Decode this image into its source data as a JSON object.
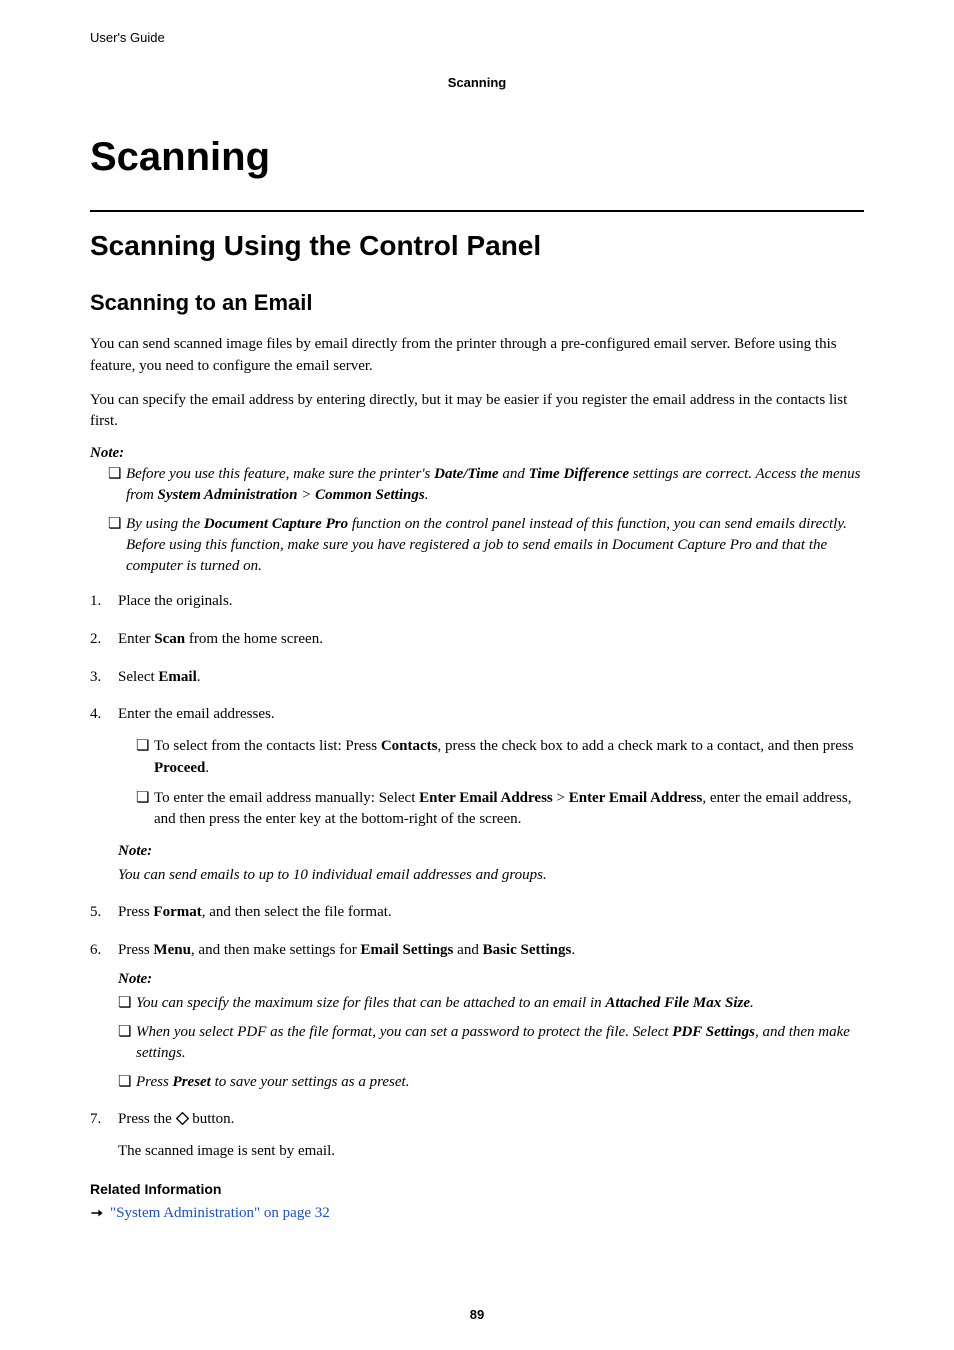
{
  "header": {
    "guide_label": "User's Guide",
    "section": "Scanning"
  },
  "titles": {
    "h1": "Scanning",
    "h2": "Scanning Using the Control Panel",
    "h3": "Scanning to an Email"
  },
  "intro": {
    "p1": "You can send scanned image files by email directly from the printer through a pre-configured email server. Before using this feature, you need to configure the email server.",
    "p2": "You can specify the email address by entering directly, but it may be easier if you register the email address in the contacts list first."
  },
  "top_note": {
    "label": "Note:",
    "item1_pre": "Before you use this feature, make sure the printer's ",
    "item1_b1": "Date/Time",
    "item1_mid1": " and ",
    "item1_b2": "Time Difference",
    "item1_mid2": " settings are correct. Access the menus from ",
    "item1_b3": "System Administration",
    "item1_gt": " > ",
    "item1_b4": "Common Settings",
    "item1_end": ".",
    "item2_pre": "By using the ",
    "item2_b1": "Document Capture Pro",
    "item2_post": " function on the control panel instead of this function, you can send emails directly. Before using this function, make sure you have registered a job to send emails in Document Capture Pro and that the computer is turned on."
  },
  "steps": {
    "s1": "Place the originals.",
    "s2_pre": "Enter ",
    "s2_b": "Scan",
    "s2_post": " from the home screen.",
    "s3_pre": "Select ",
    "s3_b": "Email",
    "s3_post": ".",
    "s4": "Enter the email addresses.",
    "s4_sub1_pre": "To select from the contacts list: Press ",
    "s4_sub1_b1": "Contacts",
    "s4_sub1_mid": ", press the check box to add a check mark to a contact, and then press ",
    "s4_sub1_b2": "Proceed",
    "s4_sub1_end": ".",
    "s4_sub2_pre": "To enter the email address manually: Select ",
    "s4_sub2_b1": "Enter Email Address",
    "s4_sub2_gt": " > ",
    "s4_sub2_b2": "Enter Email Address",
    "s4_sub2_post": ", enter the email address, and then press the enter key at the bottom-right of the screen.",
    "s4_note_label": "Note:",
    "s4_note_text": "You can send emails to up to 10 individual email addresses and groups.",
    "s5_pre": "Press ",
    "s5_b": "Format",
    "s5_post": ", and then select the file format.",
    "s6_pre": "Press ",
    "s6_b1": "Menu",
    "s6_mid": ", and then make settings for ",
    "s6_b2": "Email Settings",
    "s6_and": " and ",
    "s6_b3": "Basic Settings",
    "s6_end": ".",
    "s6_note_label": "Note:",
    "s6_n1_pre": "You can specify the maximum size for files that can be attached to an email in ",
    "s6_n1_b": "Attached File Max Size",
    "s6_n1_end": ".",
    "s6_n2_pre": "When you select PDF as the file format, you can set a password to protect the file. Select ",
    "s6_n2_b": "PDF Settings",
    "s6_n2_end": ", and then make settings.",
    "s6_n3_pre": "Press ",
    "s6_n3_b": "Preset",
    "s6_n3_end": " to save your settings as a preset.",
    "s7_pre": "Press the ",
    "s7_post": " button.",
    "s7_result": "The scanned image is sent by email."
  },
  "related": {
    "heading": "Related Information",
    "link1": "\"System Administration\" on page 32"
  },
  "page_number": "89"
}
